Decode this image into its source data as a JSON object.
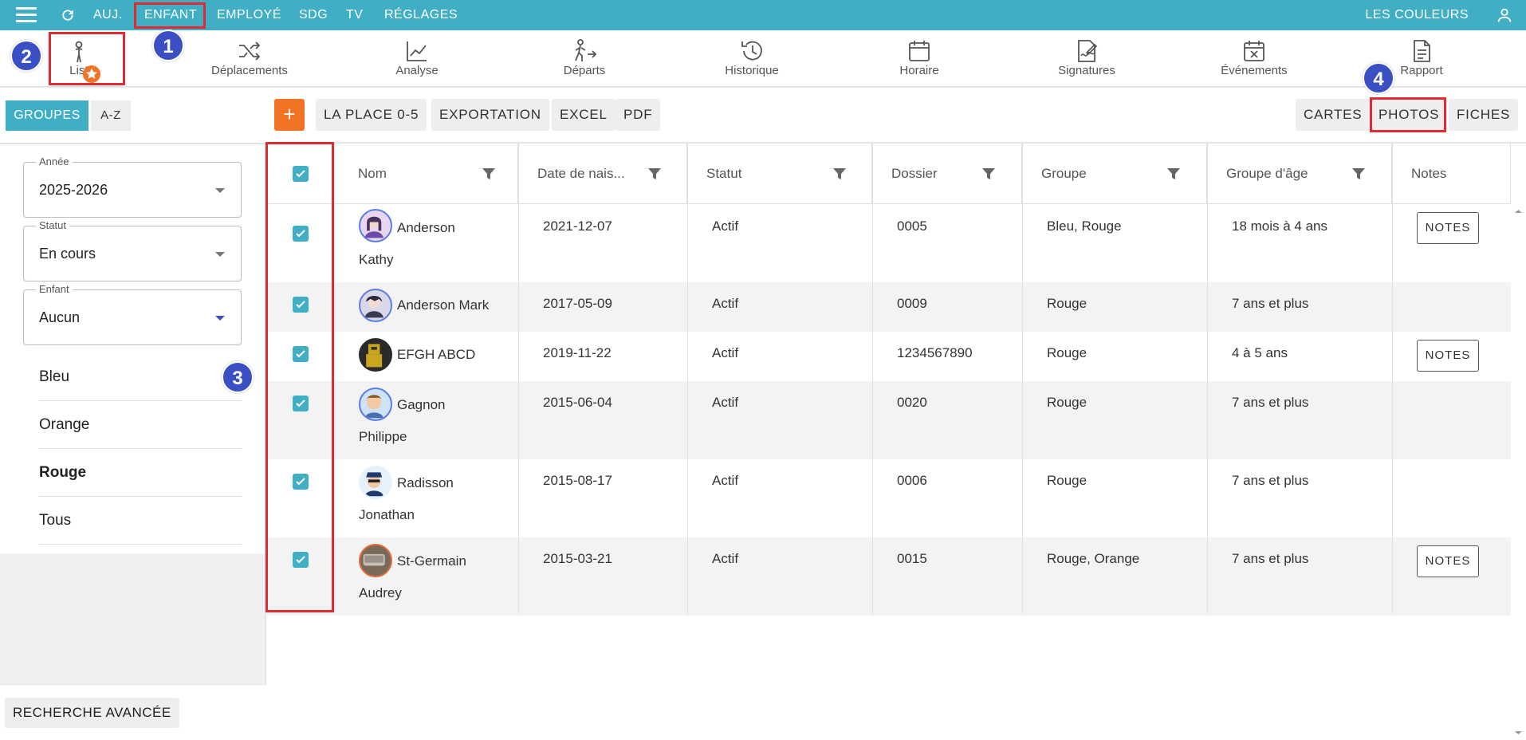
{
  "topbar": {
    "nav": [
      "AUJ.",
      "ENFANT",
      "EMPLOYÉ",
      "SDG",
      "TV",
      "RÉGLAGES"
    ],
    "right_label": "LES COULEURS",
    "color": "#40afc6"
  },
  "toolbar": {
    "items": [
      "Liste",
      "Déplacements",
      "Analyse",
      "Départs",
      "Historique",
      "Horaire",
      "Signatures",
      "Événements",
      "Rapport"
    ]
  },
  "steps": [
    "1",
    "2",
    "3",
    "4"
  ],
  "sidebar": {
    "tabs": [
      "GROUPES",
      "A-Z"
    ],
    "filters": [
      {
        "label": "Année",
        "value": "2025-2026"
      },
      {
        "label": "Statut",
        "value": "En cours"
      },
      {
        "label": "Enfant",
        "value": "Aucun"
      }
    ],
    "groups": [
      "Bleu",
      "Orange",
      "Rouge",
      "Tous"
    ],
    "selected_group": "Rouge",
    "advanced_search": "RECHERCHE AVANCÉE"
  },
  "actions": {
    "add": "+",
    "left": [
      "LA PLACE 0-5",
      "EXPORTATION",
      "EXCEL",
      "PDF"
    ],
    "right": [
      "CARTES",
      "PHOTOS",
      "FICHES"
    ],
    "accent": "#f27323"
  },
  "table": {
    "columns": [
      "Nom",
      "Date de nais...",
      "Statut",
      "Dossier",
      "Groupe",
      "Groupe d'âge",
      "Notes"
    ],
    "notes_label": "NOTES",
    "rows": [
      {
        "name1": "Anderson",
        "name2": "Kathy",
        "dob": "2021-12-07",
        "status": "Actif",
        "file": "0005",
        "group": "Bleu, Rouge",
        "age": "18 mois à 4 ans",
        "notes": true
      },
      {
        "name1": "Anderson Mark",
        "name2": "",
        "dob": "2017-05-09",
        "status": "Actif",
        "file": "0009",
        "group": "Rouge",
        "age": "7 ans et plus",
        "notes": false
      },
      {
        "name1": "EFGH ABCD",
        "name2": "",
        "dob": "2019-11-22",
        "status": "Actif",
        "file": "1234567890",
        "group": "Rouge",
        "age": "4 à 5 ans",
        "notes": true
      },
      {
        "name1": "Gagnon",
        "name2": "Philippe",
        "dob": "2015-06-04",
        "status": "Actif",
        "file": "0020",
        "group": "Rouge",
        "age": "7 ans et plus",
        "notes": false
      },
      {
        "name1": "Radisson",
        "name2": "Jonathan",
        "dob": "2015-08-17",
        "status": "Actif",
        "file": "0006",
        "group": "Rouge",
        "age": "7 ans et plus",
        "notes": false
      },
      {
        "name1": "St-Germain",
        "name2": "Audrey",
        "dob": "2015-03-21",
        "status": "Actif",
        "file": "0015",
        "group": "Rouge, Orange",
        "age": "7 ans et plus",
        "notes": true
      }
    ]
  }
}
